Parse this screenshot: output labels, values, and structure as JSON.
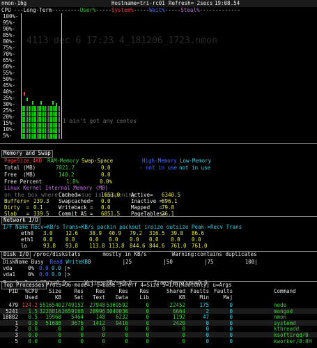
{
  "header": {
    "left": "nmon-16g",
    "host": "Hostname=tri-rc01",
    "refresh": "Refresh= 2secs",
    "time": "19:08.54"
  },
  "cpu_graph": {
    "title_cpu": "CPU",
    "title_long": "Long-Term",
    "legend_user": "User%",
    "legend_system": "System%",
    "legend_wait": "Wait%",
    "legend_steal": "Steal%",
    "ylabels": [
      "100%-",
      "95%-",
      "90%-",
      "85%-",
      "80%-",
      "75%-",
      "70%-",
      "65%-",
      "60%-",
      "55%-",
      "50%-",
      "45%-",
      "40%-",
      "35%-",
      "30%-",
      "25%-",
      "20%-",
      "15%-",
      "10%-",
      "5%-"
    ],
    "ghost_title": "4113 dec  6 17:23    4_181206_1723.nmon",
    "ghost_note": "I ain't got any centos",
    "colors": {
      "user": "#00cc00",
      "system": "#ff4040",
      "wait": "#4c6cff",
      "steal": "#c070e0"
    }
  },
  "memory": {
    "title": "Memory and Swap",
    "col_pagesize": "PageSize:4KB",
    "col_ram": "RAM-Memory",
    "col_swap": "Swap-Space",
    "col_high": "High-Memory",
    "col_low": "Low-Memory",
    "rows": [
      {
        "label": "Total (MB)",
        "ram": "7821.7",
        "swap": "0.0",
        "high": "- not in use",
        "low": "- not in use"
      },
      {
        "label": "Free  (MB)",
        "ram": "140.2",
        "swap": "0.0",
        "high": "",
        "low": ""
      },
      {
        "label": "Free Percent",
        "ram": "1.8%",
        "swap": "0.0%",
        "high": "",
        "low": ""
      }
    ],
    "kernel_title": "Linux Kernel Internal Memory (MB)",
    "kernel_rows": [
      {
        "a_label": "",
        "a_val": "",
        "b_label": "Cached=",
        "b_val": "1653.0",
        "c_label": "Active=",
        "c_val": "6340.5"
      },
      {
        "a_label": "Buffers=",
        "a_val": "239.3",
        "b_label": "Swapcached=",
        "b_val": "0.0",
        "c_label": "Inactive =",
        "c_val": "896.1"
      },
      {
        "a_label": "Dirty  =",
        "a_val": "0.1",
        "b_label": "Writeback =",
        "b_val": "0.0",
        "c_label": "Mapped   =",
        "c_val": "79.8"
      },
      {
        "a_label": "Slab   =",
        "a_val": "339.5",
        "b_label": "Commit_AS =",
        "b_val": "6851.5",
        "c_label": "PageTables=",
        "c_val": "26.1"
      }
    ],
    "ghost_note": "on the box where the issue is happening"
  },
  "network": {
    "title": "Network I/O",
    "header": "I/F Name Recv=KB/s Trans=KB/s packin packout insize outsize Peak->Recv Trans",
    "rows": [
      {
        "name": "eth0",
        "recv": "3.0",
        "trans": "12.6",
        "packin": "38.9",
        "packout": "40.9",
        "insize": "79.2",
        "outsize": "316.5",
        "peak_recv": "39.8",
        "peak_trans": "86.6"
      },
      {
        "name": "eth1",
        "recv": "0.0",
        "trans": "0.0",
        "packin": "0.0",
        "packout": "0.0",
        "insize": "0.0",
        "outsize": "0.0",
        "peak_recv": "0.0",
        "peak_trans": "0.0"
      },
      {
        "name": "lo",
        "recv": "93.8",
        "trans": "93.8",
        "packin": "113.8",
        "packout": "113.8",
        "insize": "844.6",
        "outsize": "844.6",
        "peak_recv": "761.0",
        "peak_trans": "761.0"
      }
    ]
  },
  "disk": {
    "title": "Disk I/O",
    "title_rest": "/proc/diskstats       mostly in KB/s        Warning:contains duplicates",
    "header_name": "DiskName Busy",
    "header_read": "Read",
    "header_write": "WriteKB",
    "header_scale": "0          |25          |50          |75          100|",
    "rows": [
      {
        "name": "vda",
        "busy": "0%",
        "read": "0.0",
        "write": "0.0",
        "bar": "|>"
      },
      {
        "name": "vda1",
        "busy": "0%",
        "read": "0.0",
        "write": "0.0",
        "bar": "|>"
      }
    ],
    "totals": "Totals Read-MB/s=0.0      Writes-MB/s=0.0       Transfers/sec=0.0"
  },
  "top": {
    "title": "Top Processes",
    "title_rest": "Procs=96-mode=3-1=Base 3=Perf 4=Size 5=I/O[RootOnly] u=Args",
    "header1": [
      "PID",
      "%CPU",
      "Size",
      "Res",
      "Res",
      "Res",
      "Res",
      "Shared",
      "Faults",
      "Faults",
      "Command"
    ],
    "header2": [
      "",
      "Used",
      "KB",
      "Set",
      "Text",
      "Data",
      "Lib",
      "KB",
      "Min",
      "Maj",
      ""
    ],
    "rows": [
      {
        "pid": "479",
        "cpu": "124.2",
        "size": "5516540",
        "set": "2749152",
        "text": "27948",
        "data": "5369592",
        "lib": "0",
        "shared": "22452",
        "min": "175",
        "maj": "0",
        "cmd": "node"
      },
      {
        "pid": "5241",
        "cpu": "1.5",
        "size": "3228816",
        "set": "2659168",
        "text": "28996",
        "data": "3040036",
        "lib": "0",
        "shared": "6664",
        "min": "2",
        "maj": "0",
        "cmd": "mongod"
      },
      {
        "pid": "18882",
        "cpu": "0.5",
        "size": "19968",
        "set": "5464",
        "text": "148",
        "data": "6232",
        "lib": "0",
        "shared": "1192",
        "min": "47",
        "maj": "0",
        "cmd": "nmon"
      },
      {
        "pid": "1",
        "cpu": "0.0",
        "size": "51688",
        "set": "3676",
        "text": "1412",
        "data": "9416",
        "lib": "0",
        "shared": "2420",
        "min": "0",
        "maj": "0",
        "cmd": "systemd"
      },
      {
        "pid": "2",
        "cpu": "0.0",
        "size": "0",
        "set": "0",
        "text": "0",
        "data": "0",
        "lib": "0",
        "shared": "0",
        "min": "0",
        "maj": "0",
        "cmd": "kthreadd"
      },
      {
        "pid": "3",
        "cpu": "0.0",
        "size": "0",
        "set": "0",
        "text": "0",
        "data": "0",
        "lib": "0",
        "shared": "0",
        "min": "0",
        "maj": "0",
        "cmd": "ksoftirqd/0"
      },
      {
        "pid": "5",
        "cpu": "0.0",
        "size": "0",
        "set": "0",
        "text": "0",
        "data": "0",
        "lib": "0",
        "shared": "0",
        "min": "0",
        "maj": "0",
        "cmd": "kworker/0:0H"
      }
    ]
  }
}
